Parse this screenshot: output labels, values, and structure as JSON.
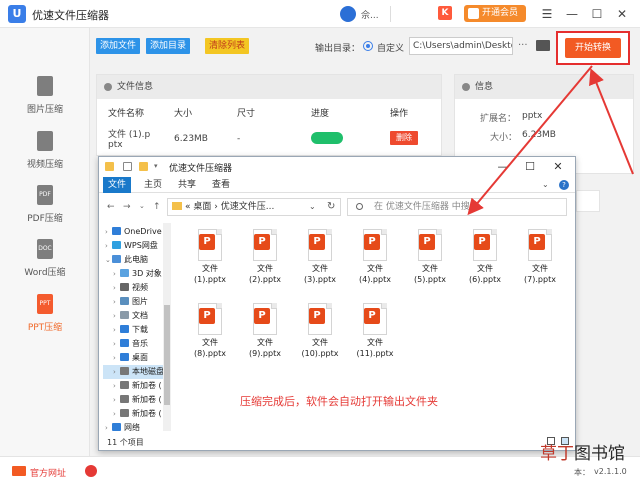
{
  "app": {
    "title": "优速文件压缩器",
    "logo_letter": "U",
    "account_name": "佘...",
    "vip_button": "开通会员",
    "k_icon": "K"
  },
  "window_controls": {
    "menu": "☰",
    "minimize": "—",
    "maximize": "☐",
    "close": "✕"
  },
  "sidebar": {
    "items": [
      {
        "label": "图片压缩",
        "icon": "image-file-icon",
        "badge": "",
        "active": false
      },
      {
        "label": "视频压缩",
        "icon": "video-file-icon",
        "badge": "",
        "active": false
      },
      {
        "label": "PDF压缩",
        "icon": "pdf-file-icon",
        "badge": "PDF",
        "active": false
      },
      {
        "label": "Word压缩",
        "icon": "word-file-icon",
        "badge": "DOC",
        "active": false
      },
      {
        "label": "PPT压缩",
        "icon": "ppt-file-icon",
        "badge": "PPT",
        "active": true
      }
    ]
  },
  "toolbar": {
    "add_file": "添加文件",
    "add_dir": "添加目录",
    "clear_list": "清除列表",
    "output_label": "输出目录：",
    "radio_custom": "自定义",
    "output_path": "C:\\Users\\admin\\Deskto",
    "more": "···",
    "start": "开始转换"
  },
  "file_panel": {
    "title": "文件信息",
    "columns": [
      "文件名称",
      "大小",
      "尺寸",
      "进度",
      "操作"
    ],
    "row": {
      "name_line1": "文件 (1).p",
      "name_line2": "ptx",
      "size": "6.23MB",
      "dimension": "-",
      "progress": 1.0,
      "action": "删除"
    }
  },
  "info_panel": {
    "title": "信息",
    "ext_label": "扩展名：",
    "ext_value": "pptx",
    "size_label": "大小：",
    "size_value": "6.23MB"
  },
  "explorer": {
    "title": "优速文件压缩器",
    "ribbon_tabs": [
      "文件",
      "主页",
      "共享",
      "查看"
    ],
    "help": "?",
    "address": [
      "«",
      "桌面",
      "›",
      "优速文件压..."
    ],
    "search_placeholder": "在 优速文件压缩器 中搜索",
    "tree": [
      {
        "label": "OneDrive",
        "icon": "onedrive-icon",
        "color": "#2f7ed8",
        "chev": "›",
        "indent": 1,
        "selected": false
      },
      {
        "label": "WPS网盘",
        "icon": "cloud-icon",
        "color": "#2fa0e0",
        "chev": "›",
        "indent": 1,
        "selected": false
      },
      {
        "label": "此电脑",
        "icon": "computer-icon",
        "color": "#4a8fd8",
        "chev": "⌄",
        "indent": 1,
        "selected": false
      },
      {
        "label": "3D 对象",
        "icon": "3d-objects-icon",
        "color": "#5aa2e0",
        "chev": "›",
        "indent": 2,
        "selected": false
      },
      {
        "label": "视频",
        "icon": "videos-icon",
        "color": "#666666",
        "chev": "›",
        "indent": 2,
        "selected": false
      },
      {
        "label": "图片",
        "icon": "pictures-icon",
        "color": "#5a8fbe",
        "chev": "›",
        "indent": 2,
        "selected": false
      },
      {
        "label": "文档",
        "icon": "documents-icon",
        "color": "#8a9aa8",
        "chev": "›",
        "indent": 2,
        "selected": false
      },
      {
        "label": "下载",
        "icon": "downloads-icon",
        "color": "#2f7ed8",
        "chev": "›",
        "indent": 2,
        "selected": false
      },
      {
        "label": "音乐",
        "icon": "music-icon",
        "color": "#2f7ed8",
        "chev": "›",
        "indent": 2,
        "selected": false
      },
      {
        "label": "桌面",
        "icon": "desktop-icon",
        "color": "#2f7ed8",
        "chev": "›",
        "indent": 2,
        "selected": false
      },
      {
        "label": "本地磁盘",
        "icon": "local-disk-icon",
        "color": "#777777",
        "chev": "›",
        "indent": 2,
        "selected": true
      },
      {
        "label": "新加卷 (",
        "icon": "drive-icon",
        "color": "#777777",
        "chev": "›",
        "indent": 2,
        "selected": false
      },
      {
        "label": "新加卷 (",
        "icon": "drive-icon",
        "color": "#777777",
        "chev": "›",
        "indent": 2,
        "selected": false
      },
      {
        "label": "新加卷 (",
        "icon": "drive-icon",
        "color": "#777777",
        "chev": "›",
        "indent": 2,
        "selected": false
      },
      {
        "label": "网络",
        "icon": "network-icon",
        "color": "#2f7ed8",
        "chev": "›",
        "indent": 1,
        "selected": false
      }
    ],
    "files": [
      {
        "line1": "文件",
        "line2": "(1).pptx"
      },
      {
        "line1": "文件",
        "line2": "(2).pptx"
      },
      {
        "line1": "文件",
        "line2": "(3).pptx"
      },
      {
        "line1": "文件",
        "line2": "(4).pptx"
      },
      {
        "line1": "文件",
        "line2": "(5).pptx"
      },
      {
        "line1": "文件",
        "line2": "(6).pptx"
      },
      {
        "line1": "文件",
        "line2": "(7).pptx"
      },
      {
        "line1": "文件",
        "line2": "(8).pptx"
      },
      {
        "line1": "文件",
        "line2": "(9).pptx"
      },
      {
        "line1": "文件",
        "line2": "(10).pptx"
      },
      {
        "line1": "文件",
        "line2": "(11).pptx"
      }
    ],
    "file_badge": "P",
    "status": "11 个项目"
  },
  "caption": "压缩完成后，软件会自动打开输出文件夹",
  "bottom": {
    "site": "官方网址",
    "version_prefix": "本：",
    "version": "v2.1.1.0"
  },
  "watermark": {
    "part1": "草丁",
    "part2": "图书馆"
  },
  "colors": {
    "accent": "#f25a23",
    "blue": "#2d93e8",
    "arrow": "#e53935",
    "progress": "#1fbf6b"
  }
}
